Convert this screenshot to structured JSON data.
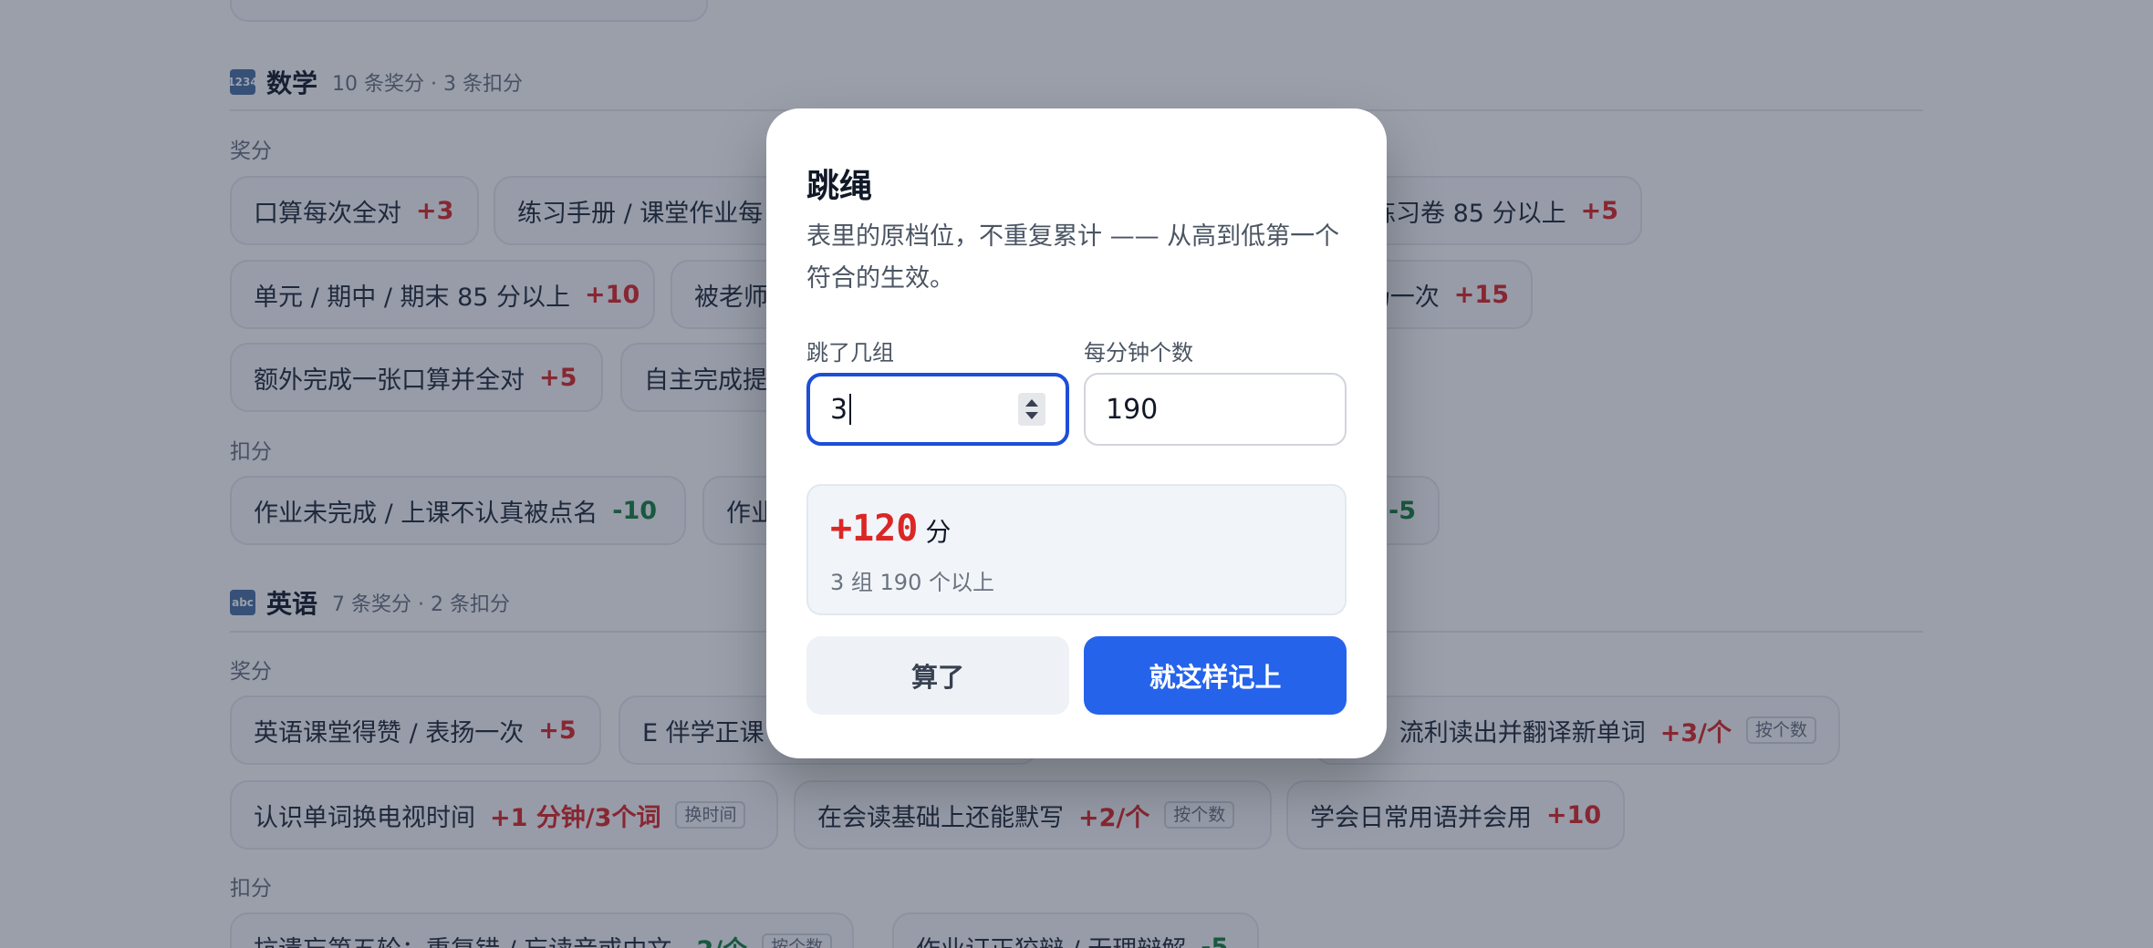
{
  "background": {
    "top_chip": {
      "label": "",
      "points": ""
    },
    "sections": [
      {
        "icon_text": "1234",
        "title": "数学",
        "meta": "10 条奖分 · 3 条扣分",
        "reward_label": "奖分",
        "penalty_label": "扣分",
        "reward_chips": [
          {
            "label": "口算每次全对",
            "points": "+3"
          },
          {
            "label": "练习手册 / 课堂作业每",
            "points": ""
          },
          {
            "label": "练习卷 85 分以上",
            "points": "+5"
          },
          {
            "label": "单元 / 期中 / 期末 85 分以上",
            "points": "+10"
          },
          {
            "label": "被老师",
            "points": ""
          },
          {
            "label": "扬一次",
            "points": "+15"
          },
          {
            "label": "额外完成一张口算并全对",
            "points": "+5"
          },
          {
            "label": "自主完成提",
            "points": ""
          }
        ],
        "penalty_chips": [
          {
            "label": "作业未完成 / 上课不认真被点名",
            "points": "-10"
          },
          {
            "label": "作业",
            "points": ""
          },
          {
            "label": "",
            "points": "-5"
          }
        ]
      },
      {
        "icon_text": "abc",
        "title": "英语",
        "meta": "7 条奖分 · 2 条扣分",
        "reward_label": "奖分",
        "penalty_label": "扣分",
        "reward_chips": [
          {
            "label": "英语课堂得赞 / 表扬一次",
            "points": "+5"
          },
          {
            "label": "E 伴学正课",
            "points": ""
          },
          {
            "label": "流利读出并翻译新单词",
            "points": "+3/个",
            "tag": "按个数"
          },
          {
            "label": "认识单词换电视时间",
            "points": "+1 分钟/3个词",
            "tag": "换时间"
          },
          {
            "label": "在会读基础上还能默写",
            "points": "+2/个",
            "tag": "按个数"
          },
          {
            "label": "学会日常用语并会用",
            "points": "+10"
          }
        ],
        "penalty_chips": [
          {
            "label": "抗遗忘第五轮：重复错 / 忘读音或中文",
            "points": "-2/个",
            "tag": "按个数"
          },
          {
            "label": "作业订正狡辩 / 无理辩解",
            "points": "-5"
          }
        ]
      }
    ]
  },
  "modal": {
    "title": "跳绳",
    "description": "表里的原档位，不重复累计 —— 从高到低第一个符合的生效。",
    "fields": {
      "groups": {
        "label": "跳了几组",
        "value": "3"
      },
      "per_minute": {
        "label": "每分钟个数",
        "value": "190"
      }
    },
    "result": {
      "value": "+120",
      "unit": "分",
      "sub": "3 组 190 个以上"
    },
    "buttons": {
      "cancel": "算了",
      "confirm": "就这样记上"
    }
  },
  "colors": {
    "accent": "#2563eb",
    "positive": "#dc2626",
    "negative": "#15803d",
    "overlay": "rgba(30,42,66,0.45)"
  }
}
